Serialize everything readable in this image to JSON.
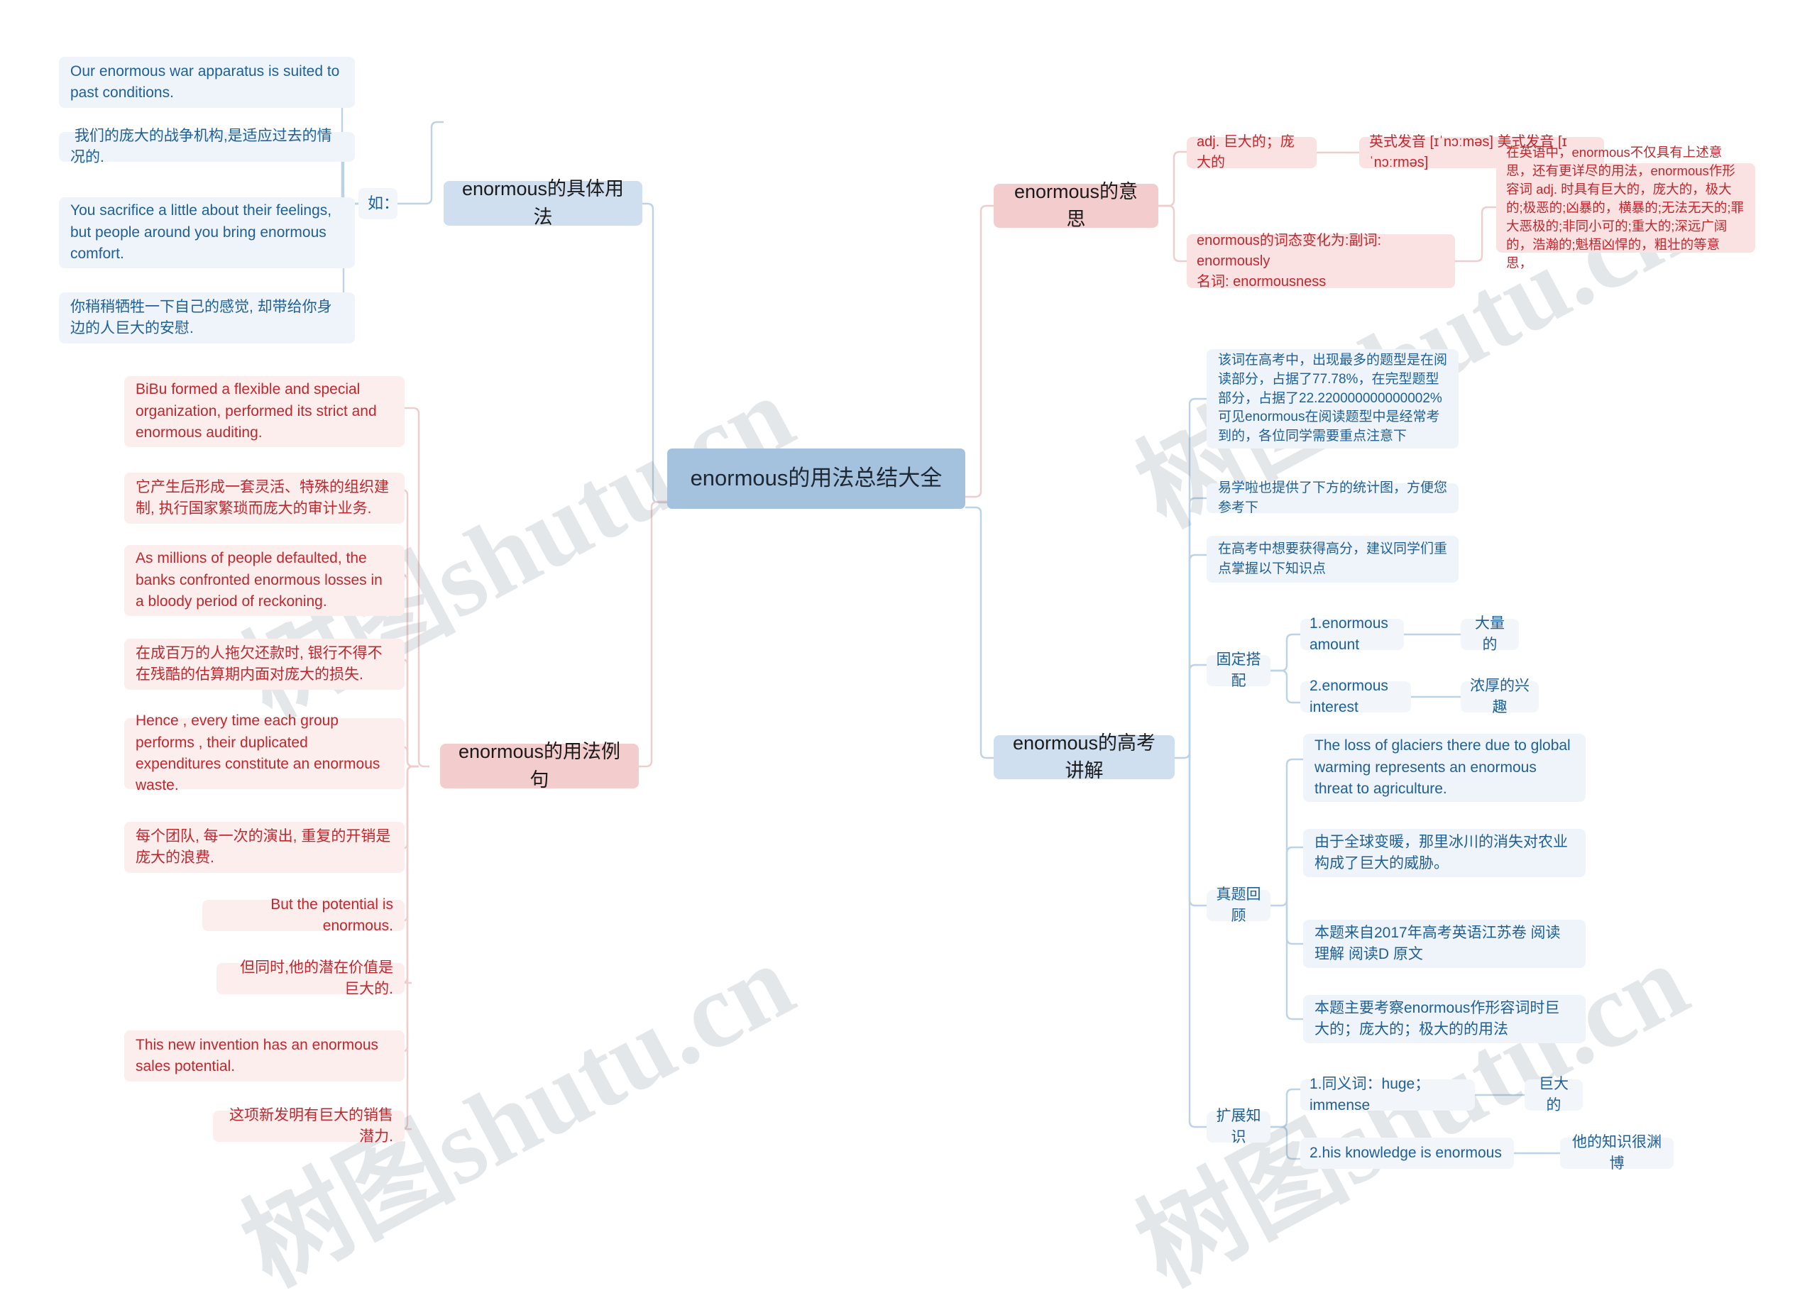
{
  "root": {
    "title": "enormous的用法总结大全"
  },
  "watermark": {
    "text": "树图shutu.cn"
  },
  "left": {
    "branches": [
      {
        "label": "enormous的具体用法",
        "connector_label": "如：",
        "leaves": [
          "Our enormous war apparatus is suited to past conditions.",
          " 我们的庞大的战争机构,是适应过去的情况的.",
          "You sacrifice a little about their feelings, but people around you bring enormous comfort.",
          "你稍稍牺牲一下自己的感觉, 却带给你身边的人巨大的安慰."
        ]
      },
      {
        "label": "enormous的用法例句",
        "leaves": [
          "BiBu formed a flexible and special organization, performed its strict and enormous auditing.",
          "它产生后形成一套灵活、特殊的组织建制, 执行国家繁琐而庞大的审计业务.",
          "As millions of people defaulted, the banks confronted enormous losses in a bloody period of reckoning.",
          "在成百万的人拖欠还款时, 银行不得不在残酷的估算期内面对庞大的损失.",
          "Hence , every time each group performs , their duplicated expenditures constitute an enormous waste.",
          "每个团队, 每一次的演出, 重复的开销是庞大的浪费.",
          "But the potential is enormous.",
          "但同时,他的潜在价值是巨大的.",
          "This new invention has an enormous sales potential.",
          "这项新发明有巨大的销售潜力."
        ]
      }
    ]
  },
  "right": {
    "meaning": {
      "label": "enormous的意思",
      "items": [
        {
          "text": "adj. 巨大的；庞大的",
          "child": "英式发音 [ɪˈnɔːməs] 美式发音 [ɪˈnɔːrməs]"
        },
        {
          "text": "enormous的词态变化为:副词: enormously\n名词: enormousness",
          "child": "在英语中，enormous不仅具有上述意思，还有更详尽的用法，enormous作形容词 adj. 时具有巨大的，庞大的，极大的;极恶的;凶暴的，横暴的;无法无天的;罪大恶极的;非同小可的;重大的;深远广阔的，浩瀚的;魁梧凶悍的，粗壮的等意思，"
        }
      ]
    },
    "gaokao": {
      "label": "enormous的高考讲解",
      "intro": [
        "该词在高考中，出现最多的题型是在阅读部分，占据了77.78%，在完型题型部分，占据了22.220000000000002%可见enormous在阅读题型中是经常考到的，各位同学需要重点注意下",
        "易学啦也提供了下方的统计图，方便您参考下",
        "在高考中想要获得高分，建议同学们重点掌握以下知识点"
      ],
      "groups": [
        {
          "label": "固定搭配",
          "pairs": [
            {
              "term": "1.enormous amount",
              "meaning": "大量的"
            },
            {
              "term": "2.enormous interest",
              "meaning": "浓厚的兴趣"
            }
          ]
        },
        {
          "label": "真题回顾",
          "items": [
            "The loss of glaciers there due to global warming represents an enormous threat to agriculture.",
            "由于全球变暖，那里冰川的消失对农业构成了巨大的威胁。",
            "本题来自2017年高考英语江苏卷 阅读理解 阅读D 原文",
            "本题主要考察enormous作形容词时巨大的；庞大的；极大的的用法"
          ]
        },
        {
          "label": "扩展知识",
          "pairs": [
            {
              "term": "1.同义词：huge；immense",
              "meaning": "巨大的"
            },
            {
              "term": "2.his knowledge is enormous",
              "meaning": "他的知识很渊博"
            }
          ]
        }
      ]
    }
  },
  "colors": {
    "root_bg": "#a4c2dd",
    "blue_branch_bg": "#cfdff0",
    "pink_branch_bg": "#f3ccce",
    "blue_leaf_bg": "#eef4fa",
    "pink_leaf_bg": "#fdeeee",
    "blue_text": "#1f5f96",
    "red_text": "#c0272d",
    "blue_link": "#bcd3e6",
    "pink_link": "#f0cdcd"
  }
}
